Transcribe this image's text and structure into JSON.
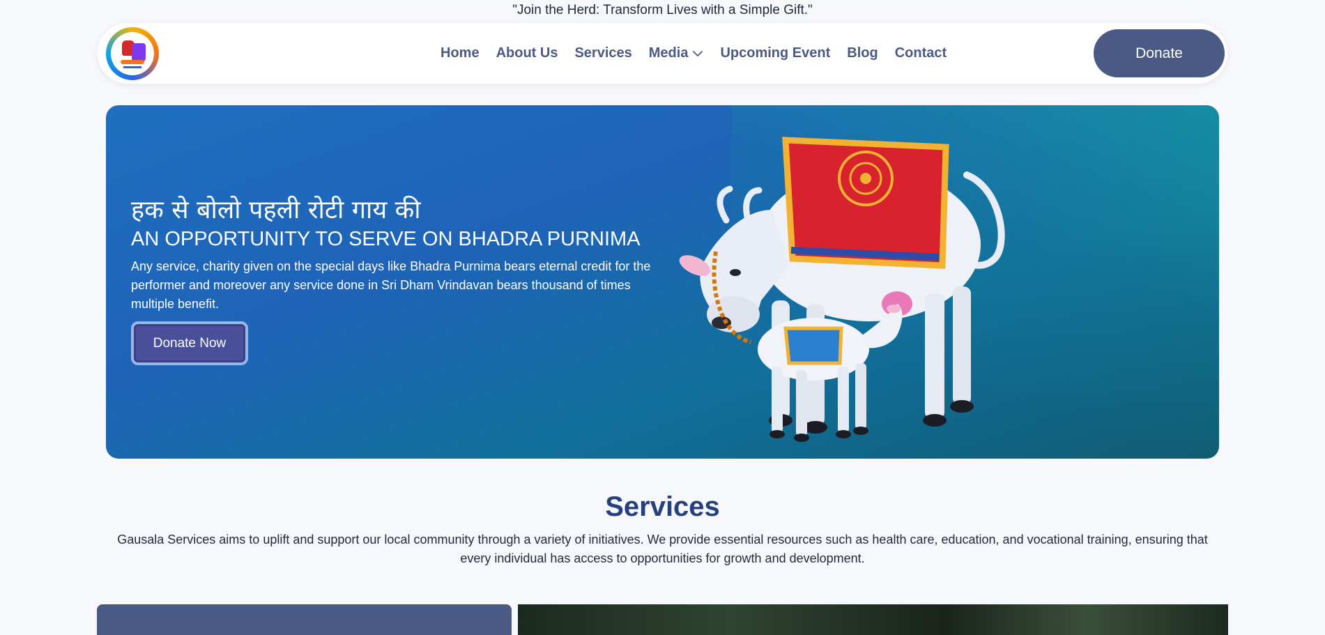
{
  "tagline": "\"Join the Herd: Transform Lives with a Simple Gift.\"",
  "nav": {
    "links": [
      "Home",
      "About Us",
      "Services",
      "Media",
      "Upcoming Event",
      "Blog",
      "Contact"
    ],
    "donate_label": "Donate"
  },
  "hero": {
    "hindi_heading": "हक से बोलो पहली रोटी गाय की",
    "title": "AN OPPORTUNITY TO SERVE ON BHADRA PURNIMA",
    "description": "Any service, charity given on the special days like Bhadra Purnima bears eternal credit for the performer and moreover any service done in Sri Dham Vrindavan bears thousand of times multiple benefit.",
    "button_label": "Donate Now"
  },
  "services": {
    "title": "Services",
    "description": "Gausala Services aims to uplift and support our local community through a variety of initiatives. We provide essential resources such as health care, education, and vocational training, ensuring that every individual has access to opportunities for growth and development."
  },
  "colors": {
    "accent": "#4a5a84",
    "heading": "#24407f",
    "hero_start": "#1f6fbf",
    "hero_end": "#0f5c73"
  },
  "icons": {
    "media_dropdown": "chevron-down-icon"
  }
}
